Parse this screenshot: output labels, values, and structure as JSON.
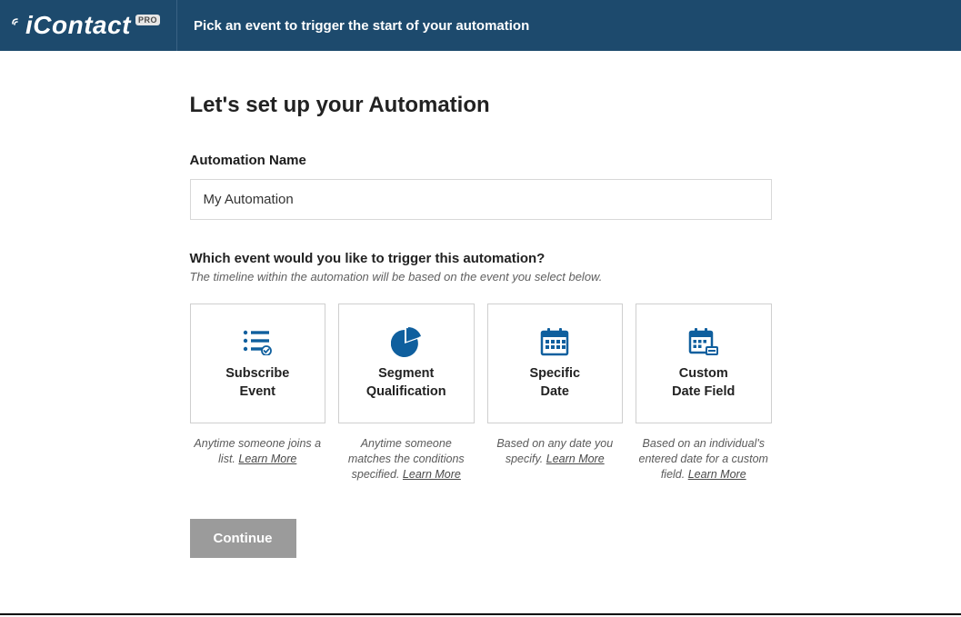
{
  "header": {
    "brand": "iContact",
    "brand_badge": "PRO",
    "subtitle": "Pick an event to trigger the start of your automation"
  },
  "main": {
    "title": "Let's set up your Automation",
    "name_label": "Automation Name",
    "name_value": "My Automation",
    "event_prompt": "Which event would you like to trigger this automation?",
    "event_hint": "The timeline within the automation will be based on the event you select below.",
    "continue_label": "Continue"
  },
  "options": [
    {
      "icon": "list-check-icon",
      "title_line1": "Subscribe",
      "title_line2": "Event",
      "desc": "Anytime someone joins a list.",
      "learn": "Learn More"
    },
    {
      "icon": "pie-chart-icon",
      "title_line1": "Segment",
      "title_line2": "Qualification",
      "desc": "Anytime someone matches the conditions specified.",
      "learn": "Learn More"
    },
    {
      "icon": "calendar-icon",
      "title_line1": "Specific",
      "title_line2": "Date",
      "desc": "Based on any date you specify.",
      "learn": "Learn More"
    },
    {
      "icon": "calendar-edit-icon",
      "title_line1": "Custom",
      "title_line2": "Date Field",
      "desc": "Based on an individual's entered date for a custom field.",
      "learn": "Learn More"
    }
  ],
  "colors": {
    "header_bg": "#1d4a6d",
    "accent": "#0f5f9e",
    "disabled": "#9b9b9b"
  }
}
